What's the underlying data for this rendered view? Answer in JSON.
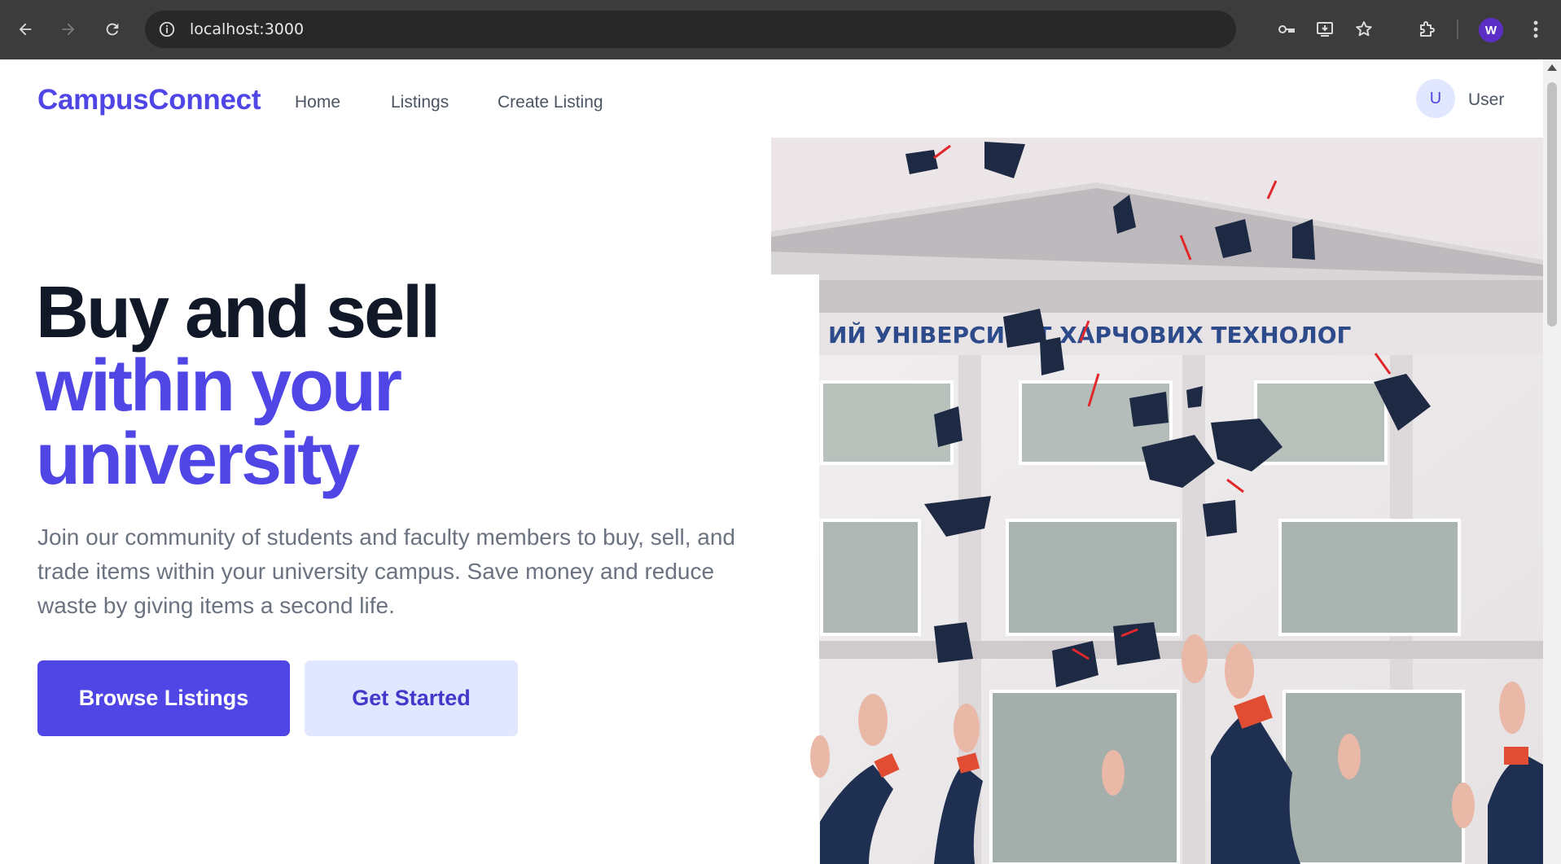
{
  "browser": {
    "url": "localhost:3000",
    "profile_initial": "W",
    "icons": [
      "back-icon",
      "forward-icon",
      "reload-icon",
      "site-info-icon",
      "password-key-icon",
      "install-app-icon",
      "bookmark-star-icon",
      "extensions-icon",
      "more-menu-icon"
    ]
  },
  "nav": {
    "brand": "CampusConnect",
    "links": [
      "Home",
      "Listings",
      "Create Listing"
    ],
    "user_initial": "U",
    "user_name": "User"
  },
  "hero": {
    "title_line1": "Buy and sell",
    "title_line2": "within your",
    "title_line3": "university",
    "description": "Join our community of students and faculty members to buy, sell, and trade items within your university campus. Save money and reduce waste by giving items a second life.",
    "primary_button": "Browse Listings",
    "secondary_button": "Get Started",
    "image_banner_text": "ИЙ УНІВЕРСИТЕТ ХАРЧОВИХ ТЕХНОЛОГ"
  },
  "colors": {
    "accent": "#4f46e5",
    "accent_light": "#e0e7ff",
    "heading": "#111827",
    "body_text": "#6b7280",
    "chrome_bg": "#3c3c3c"
  }
}
